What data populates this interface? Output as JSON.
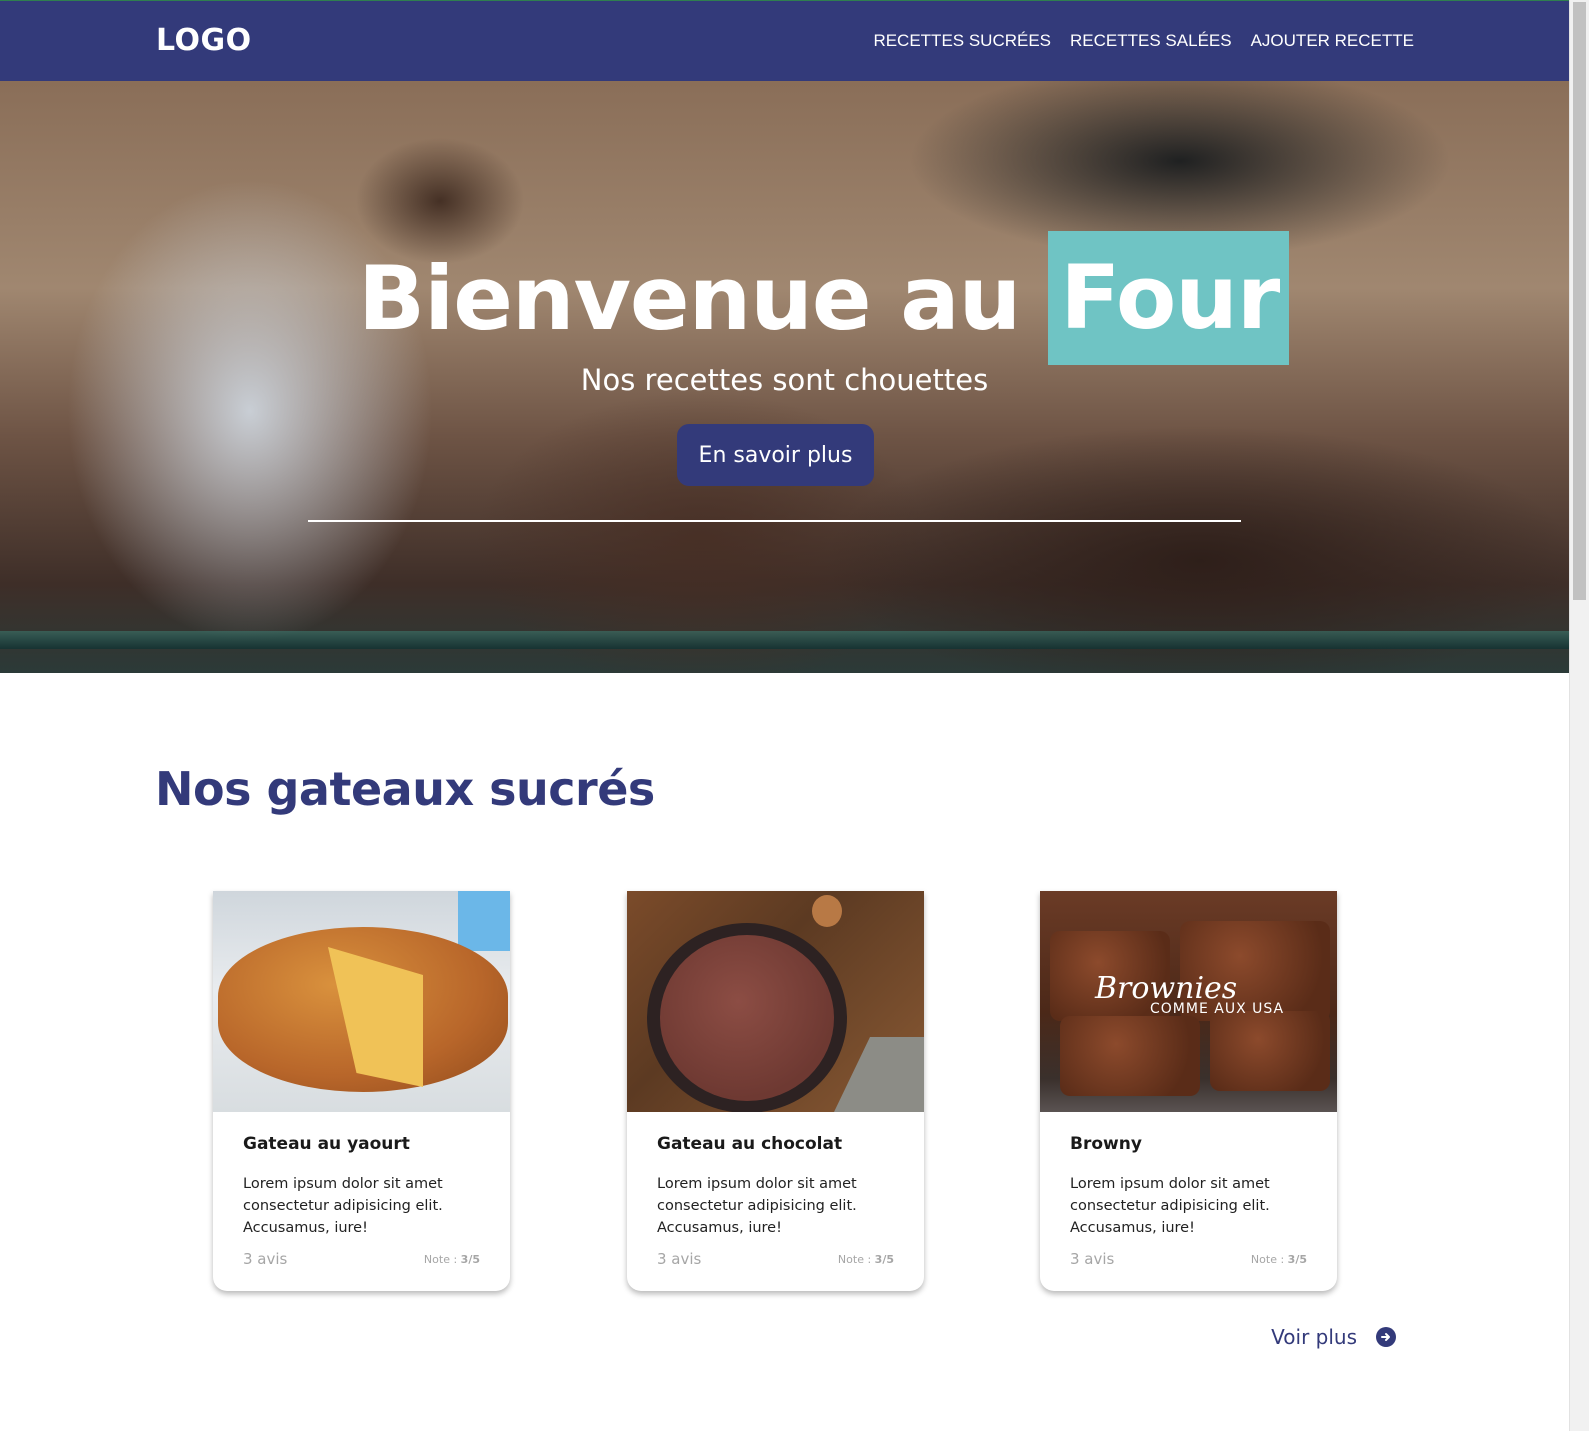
{
  "header": {
    "logo": "LOGO",
    "nav": [
      {
        "label": "RECETTES SUCRÉES"
      },
      {
        "label": "RECETTES SALÉES"
      },
      {
        "label": "AJOUTER RECETTE"
      }
    ]
  },
  "hero": {
    "title_main": "Bienvenue au",
    "title_accent": "Four",
    "subtitle": "Nos recettes sont chouettes",
    "cta_label": "En savoir plus"
  },
  "section": {
    "title": "Nos gateaux sucrés",
    "cards": [
      {
        "title": "Gateau au yaourt",
        "description": "Lorem ipsum dolor sit amet consectetur adipisicing elit. Accusamus, iure!",
        "reviews": "3 avis",
        "rating_label": "Note :",
        "rating_value": "3/5"
      },
      {
        "title": "Gateau au chocolat",
        "description": "Lorem ipsum dolor sit amet consectetur adipisicing elit. Accusamus, iure!",
        "reviews": "3 avis",
        "rating_label": "Note :",
        "rating_value": "3/5"
      },
      {
        "title": "Browny",
        "description": "Lorem ipsum dolor sit amet consectetur adipisicing elit. Accusamus, iure!",
        "reviews": "3 avis",
        "rating_label": "Note :",
        "rating_value": "3/5",
        "image_caption_script": "Brownies",
        "image_caption_sub": "COMME AUX USA"
      }
    ],
    "see_more_label": "Voir plus"
  },
  "colors": {
    "brand": "#333a7a",
    "accent": "#6fc4c4",
    "muted": "#a6a6a6"
  }
}
